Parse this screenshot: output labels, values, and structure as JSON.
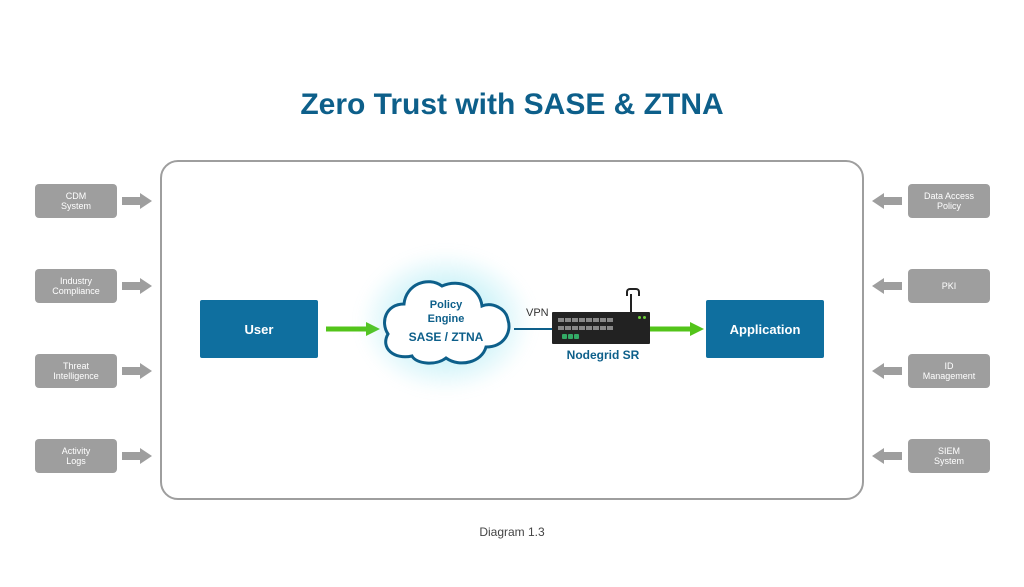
{
  "title": "Zero Trust with SASE & ZTNA",
  "caption": "Diagram 1.3",
  "left_inputs": [
    {
      "label": "CDM\nSystem"
    },
    {
      "label": "Industry\nCompliance"
    },
    {
      "label": "Threat\nIntelligence"
    },
    {
      "label": "Activity\nLogs"
    }
  ],
  "right_inputs": [
    {
      "label": "Data Access\nPolicy"
    },
    {
      "label": "PKI"
    },
    {
      "label": "ID\nManagement"
    },
    {
      "label": "SIEM\nSystem"
    }
  ],
  "flow": {
    "user_label": "User",
    "cloud_line1": "Policy",
    "cloud_line2": "Engine",
    "cloud_line3": "SASE / ZTNA",
    "vpn_label": "VPN",
    "device_label": "Nodegrid SR",
    "app_label": "Application"
  },
  "colors": {
    "primary": "#0f6f9f",
    "heading": "#0d5f8a",
    "box_gray": "#9e9e9e",
    "green_arrow": "#53c41a",
    "glow": "#58d5e8"
  }
}
